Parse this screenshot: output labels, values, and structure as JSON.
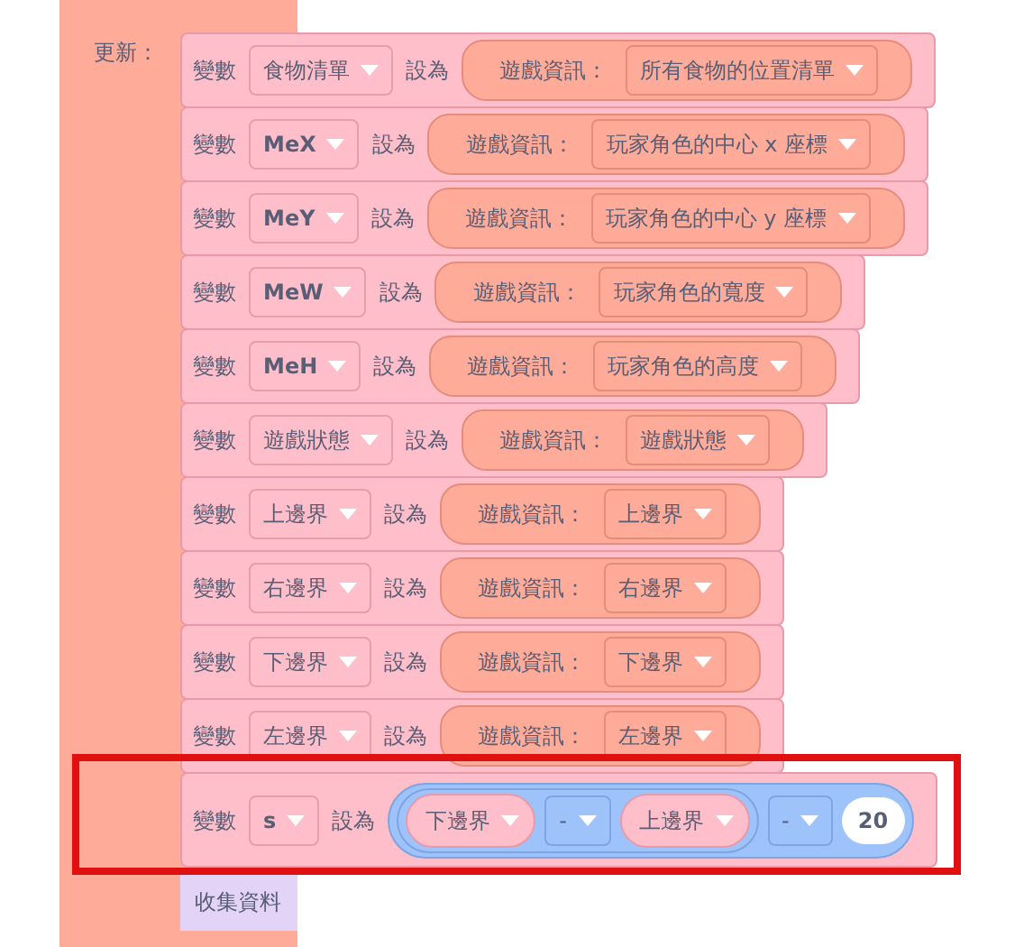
{
  "event_block": {
    "label": "更新：",
    "statements": [
      {
        "kind": "set",
        "keyword": "變數",
        "variable": "食物清單",
        "to": "設為",
        "highlighted": false,
        "value": {
          "kind": "game_info",
          "label": "遊戲資訊：",
          "option": "所有食物的位置清單"
        }
      },
      {
        "kind": "set",
        "keyword": "變數",
        "variable": "MeX",
        "to": "設為",
        "highlighted": false,
        "value": {
          "kind": "game_info",
          "label": "遊戲資訊：",
          "option": "玩家角色的中心 x 座標"
        }
      },
      {
        "kind": "set",
        "keyword": "變數",
        "variable": "MeY",
        "to": "設為",
        "highlighted": false,
        "value": {
          "kind": "game_info",
          "label": "遊戲資訊：",
          "option": "玩家角色的中心 y 座標"
        }
      },
      {
        "kind": "set",
        "keyword": "變數",
        "variable": "MeW",
        "to": "設為",
        "highlighted": false,
        "value": {
          "kind": "game_info",
          "label": "遊戲資訊：",
          "option": "玩家角色的寬度"
        }
      },
      {
        "kind": "set",
        "keyword": "變數",
        "variable": "MeH",
        "to": "設為",
        "highlighted": false,
        "value": {
          "kind": "game_info",
          "label": "遊戲資訊：",
          "option": "玩家角色的高度"
        }
      },
      {
        "kind": "set",
        "keyword": "變數",
        "variable": "遊戲狀態",
        "to": "設為",
        "highlighted": false,
        "value": {
          "kind": "game_info",
          "label": "遊戲資訊：",
          "option": "遊戲狀態"
        }
      },
      {
        "kind": "set",
        "keyword": "變數",
        "variable": "上邊界",
        "to": "設為",
        "highlighted": false,
        "value": {
          "kind": "game_info",
          "label": "遊戲資訊：",
          "option": "上邊界"
        }
      },
      {
        "kind": "set",
        "keyword": "變數",
        "variable": "右邊界",
        "to": "設為",
        "highlighted": false,
        "value": {
          "kind": "game_info",
          "label": "遊戲資訊：",
          "option": "右邊界"
        }
      },
      {
        "kind": "set",
        "keyword": "變數",
        "variable": "下邊界",
        "to": "設為",
        "highlighted": false,
        "value": {
          "kind": "game_info",
          "label": "遊戲資訊：",
          "option": "下邊界"
        }
      },
      {
        "kind": "set",
        "keyword": "變數",
        "variable": "左邊界",
        "to": "設為",
        "highlighted": false,
        "value": {
          "kind": "game_info",
          "label": "遊戲資訊：",
          "option": "左邊界"
        }
      },
      {
        "kind": "set",
        "keyword": "變數",
        "variable": "s",
        "to": "設為",
        "highlighted": true,
        "value": {
          "kind": "arith",
          "left": {
            "kind": "arith",
            "left": {
              "kind": "var",
              "name": "下邊界"
            },
            "op": "-",
            "right": {
              "kind": "var",
              "name": "上邊界"
            }
          },
          "op": "-",
          "right": {
            "kind": "number",
            "value": "20"
          }
        }
      }
    ],
    "next_block": {
      "label": "收集資料"
    }
  }
}
